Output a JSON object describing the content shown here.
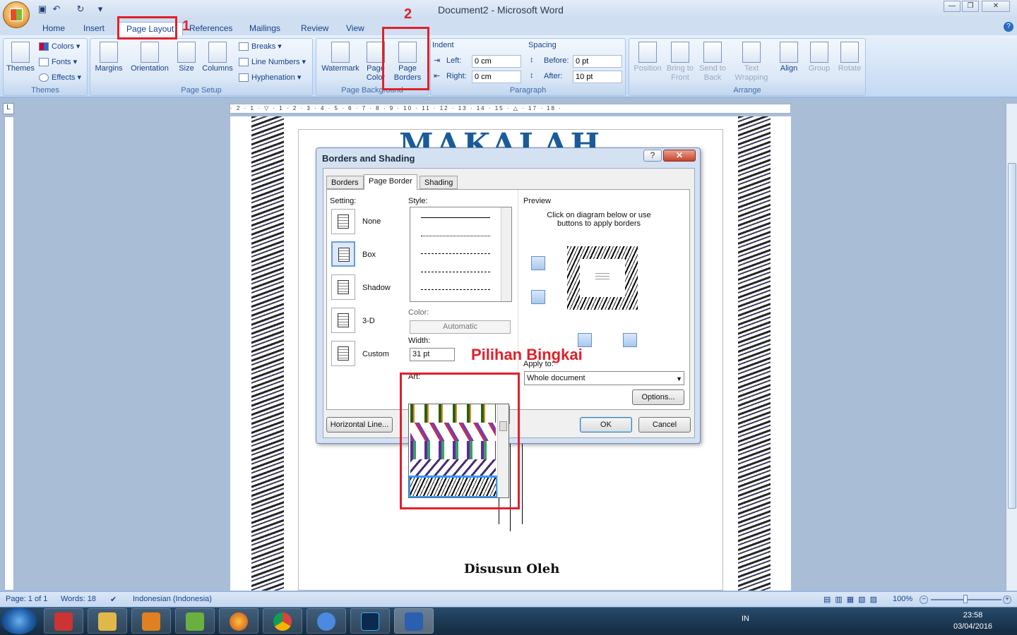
{
  "window": {
    "title": "Document2 - Microsoft Word"
  },
  "tabs": [
    "Home",
    "Insert",
    "Page Layout",
    "References",
    "Mailings",
    "Review",
    "View"
  ],
  "ribbon": {
    "themes": {
      "label": "Themes",
      "group": "Themes",
      "colors": "Colors",
      "fonts": "Fonts",
      "effects": "Effects"
    },
    "page_setup": {
      "group": "Page Setup",
      "margins": "Margins",
      "orientation": "Orientation",
      "size": "Size",
      "columns": "Columns",
      "breaks": "Breaks",
      "line_numbers": "Line Numbers",
      "hyphenation": "Hyphenation"
    },
    "page_background": {
      "group": "Page Background",
      "watermark": "Watermark",
      "page_color_1": "Page",
      "page_color_2": "Color",
      "page_borders_1": "Page",
      "page_borders_2": "Borders"
    },
    "paragraph": {
      "group": "Paragraph",
      "indent": "Indent",
      "left_label": "Left:",
      "left_value": "0 cm",
      "right_label": "Right:",
      "right_value": "0 cm",
      "spacing": "Spacing",
      "before_label": "Before:",
      "before_value": "0 pt",
      "after_label": "After:",
      "after_value": "10 pt"
    },
    "arrange": {
      "group": "Arrange",
      "position": "Position",
      "bring_1": "Bring to",
      "bring_2": "Front",
      "send_1": "Send to",
      "send_2": "Back",
      "wrap_1": "Text",
      "wrap_2": "Wrapping",
      "align": "Align",
      "group_btn": "Group",
      "rotate": "Rotate"
    }
  },
  "annotations": {
    "num1": "1",
    "num2": "2",
    "pilihan": "Pilihan Bingkai"
  },
  "ruler_text": "· 2 · 1 · ▽ · 1 · 2 · 3 · 4 · 5 · 6 · 7 · 8 · 9 · 10 · 11 · 12 · 13 · 14 · 15 · △ · 17 · 18 ·",
  "document": {
    "heading": "MAKALAH",
    "subheading": "Disusun Oleh"
  },
  "dialog": {
    "title": "Borders and Shading",
    "help": "?",
    "close": "✕",
    "tabs": [
      "Borders",
      "Page Border",
      "Shading"
    ],
    "setting_label": "Setting:",
    "settings": [
      "None",
      "Box",
      "Shadow",
      "3-D",
      "Custom"
    ],
    "style_label": "Style:",
    "color_label": "Color:",
    "color_value": "Automatic",
    "width_label": "Width:",
    "width_value": "31 pt",
    "art_label": "Art:",
    "preview_label": "Preview",
    "preview_hint_1": "Click on diagram below or use",
    "preview_hint_2": "buttons to apply borders",
    "apply_label": "Apply to:",
    "apply_value": "Whole document",
    "options": "Options...",
    "horizontal_line": "Horizontal Line...",
    "ok": "OK",
    "cancel": "Cancel"
  },
  "status": {
    "page": "Page: 1 of 1",
    "words": "Words: 18",
    "language": "Indonesian (Indonesia)",
    "zoom": "100%"
  },
  "taskbar": {
    "lang": "IN",
    "time": "23:58",
    "date": "03/04/2016"
  }
}
